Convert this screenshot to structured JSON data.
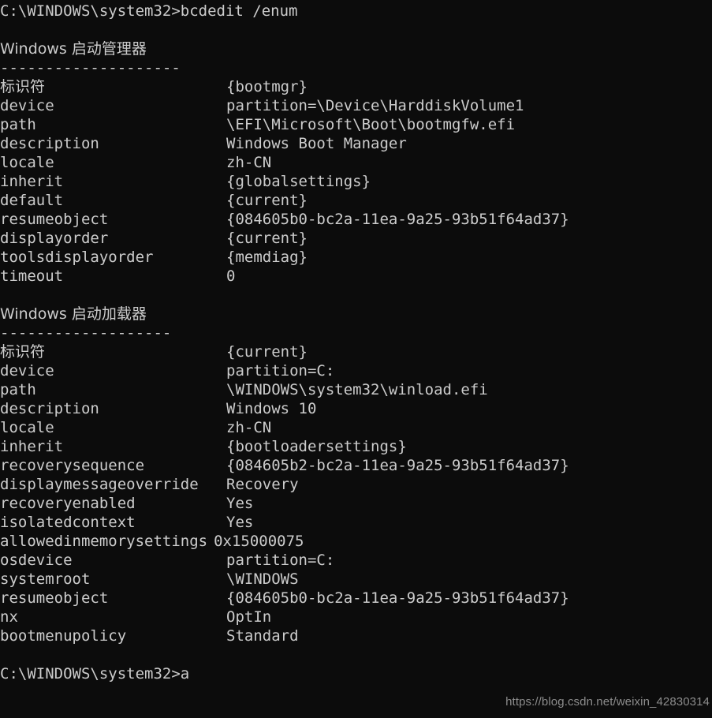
{
  "terminal": {
    "background_color": "#0c0c0c",
    "text_color": "#cccccc",
    "command_line": "C:\\WINDOWS\\system32>bcdedit /enum",
    "final_prompt": "C:\\WINDOWS\\system32>a",
    "sections": [
      {
        "title": "Windows 启动管理器",
        "separator": "--------------------",
        "entries": [
          {
            "key": "标识符",
            "value": "{bootmgr}"
          },
          {
            "key": "device",
            "value": "partition=\\Device\\HarddiskVolume1"
          },
          {
            "key": "path",
            "value": "\\EFI\\Microsoft\\Boot\\bootmgfw.efi"
          },
          {
            "key": "description",
            "value": "Windows Boot Manager"
          },
          {
            "key": "locale",
            "value": "zh-CN"
          },
          {
            "key": "inherit",
            "value": "{globalsettings}"
          },
          {
            "key": "default",
            "value": "{current}"
          },
          {
            "key": "resumeobject",
            "value": "{084605b0-bc2a-11ea-9a25-93b51f64ad37}"
          },
          {
            "key": "displayorder",
            "value": "{current}"
          },
          {
            "key": "toolsdisplayorder",
            "value": "{memdiag}"
          },
          {
            "key": "timeout",
            "value": "0"
          }
        ]
      },
      {
        "title": "Windows 启动加载器",
        "separator": "-------------------",
        "entries": [
          {
            "key": "标识符",
            "value": "{current}"
          },
          {
            "key": "device",
            "value": "partition=C:"
          },
          {
            "key": "path",
            "value": "\\WINDOWS\\system32\\winload.efi"
          },
          {
            "key": "description",
            "value": "Windows 10"
          },
          {
            "key": "locale",
            "value": "zh-CN"
          },
          {
            "key": "inherit",
            "value": "{bootloadersettings}"
          },
          {
            "key": "recoverysequence",
            "value": "{084605b2-bc2a-11ea-9a25-93b51f64ad37}"
          },
          {
            "key": "displaymessageoverride",
            "value": "Recovery"
          },
          {
            "key": "recoveryenabled",
            "value": "Yes"
          },
          {
            "key": "isolatedcontext",
            "value": "Yes"
          },
          {
            "key": "allowedinmemorysettings",
            "value": "0x15000075"
          },
          {
            "key": "osdevice",
            "value": "partition=C:"
          },
          {
            "key": "systemroot",
            "value": "\\WINDOWS"
          },
          {
            "key": "resumeobject",
            "value": "{084605b0-bc2a-11ea-9a25-93b51f64ad37}"
          },
          {
            "key": "nx",
            "value": "OptIn"
          },
          {
            "key": "bootmenupolicy",
            "value": "Standard"
          }
        ]
      }
    ]
  },
  "watermark": {
    "text": "https://blog.csdn.net/weixin_42830314",
    "color": "#8c8c8c"
  }
}
